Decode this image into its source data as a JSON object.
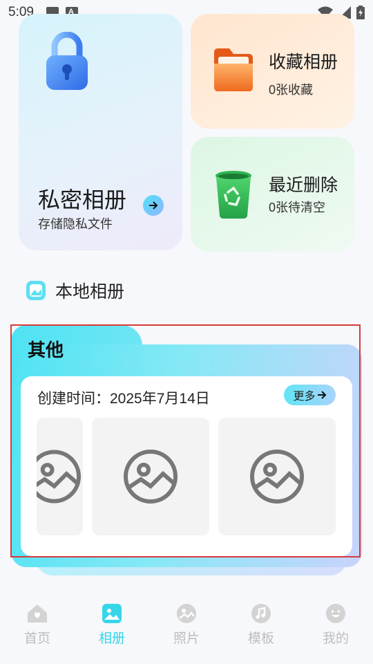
{
  "status": {
    "time": "5:09",
    "left_icons": [
      "image-icon",
      "a-icon"
    ],
    "right_icons": [
      "wifi-icon",
      "signal-icon",
      "battery-icon"
    ]
  },
  "cards": {
    "private": {
      "title": "私密相册",
      "subtitle": "存储隐私文件",
      "icon": "lock-icon"
    },
    "favorites": {
      "title": "收藏相册",
      "subtitle": "0张收藏",
      "icon": "folder-icon"
    },
    "recent_deleted": {
      "title": "最近删除",
      "subtitle": "0张待清空",
      "icon": "trash-icon"
    }
  },
  "section": {
    "title": "本地相册",
    "icon": "album-icon"
  },
  "album": {
    "name": "其他",
    "created": "创建时间：2025年7月14日",
    "more_label": "更多",
    "thumbnails": [
      "image-placeholder-icon",
      "image-placeholder-icon",
      "image-placeholder-icon"
    ]
  },
  "tabs": [
    {
      "label": "首页",
      "icon": "home-icon",
      "active": false
    },
    {
      "label": "相册",
      "icon": "album-icon",
      "active": true
    },
    {
      "label": "照片",
      "icon": "photo-icon",
      "active": false
    },
    {
      "label": "模板",
      "icon": "music-icon",
      "active": false
    },
    {
      "label": "我的",
      "icon": "smile-icon",
      "active": false
    }
  ],
  "colors": {
    "accent": "#35d6ea",
    "highlight_outline": "#d83a3a"
  }
}
